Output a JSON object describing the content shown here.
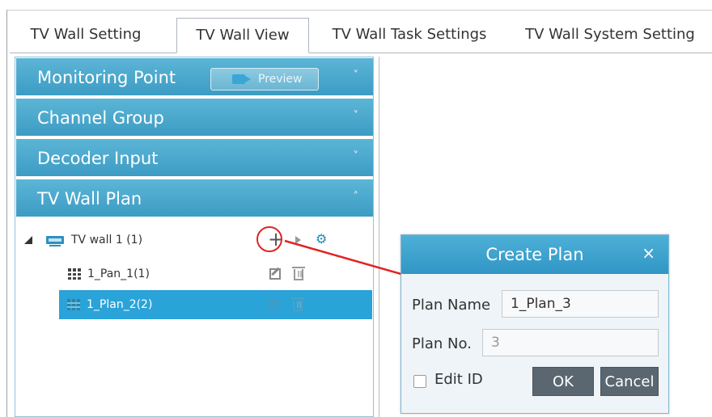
{
  "tabs": [
    {
      "label": "TV Wall Setting",
      "active": false
    },
    {
      "label": "TV Wall View",
      "active": true
    },
    {
      "label": "TV Wall Task Settings",
      "active": false
    },
    {
      "label": "TV Wall System Setting",
      "active": false
    }
  ],
  "accordion": {
    "monitoring_point": {
      "title": "Monitoring Point",
      "preview_label": "Preview",
      "chevron": "down"
    },
    "channel_group": {
      "title": "Channel Group",
      "chevron": "down"
    },
    "decoder_input": {
      "title": "Decoder Input",
      "chevron": "down"
    },
    "tv_wall_plan": {
      "title": "TV Wall Plan",
      "chevron": "up"
    }
  },
  "tree": {
    "root": {
      "label": "TV wall 1 (1)",
      "icon": "monitor-icon",
      "actions": [
        "plus-icon",
        "play-icon",
        "gear-icon"
      ]
    },
    "children": [
      {
        "label": "1_Pan_1(1)",
        "selected": false
      },
      {
        "label": "1_Plan_2(2)",
        "selected": true
      }
    ]
  },
  "dialog": {
    "title": "Create Plan",
    "close_glyph": "×",
    "plan_name_label": "Plan Name",
    "plan_name_value": "1_Plan_3",
    "plan_no_label": "Plan No.",
    "plan_no_value": "3",
    "edit_id_label": "Edit ID",
    "edit_id_checked": false,
    "ok_label": "OK",
    "cancel_label": "Cancel"
  },
  "colors": {
    "accordion_header": "#3d9cc4",
    "selected_row": "#2aa3d9",
    "dialog_header": "#3196c5",
    "annotation": "#e02424",
    "button": "#5b6770"
  }
}
